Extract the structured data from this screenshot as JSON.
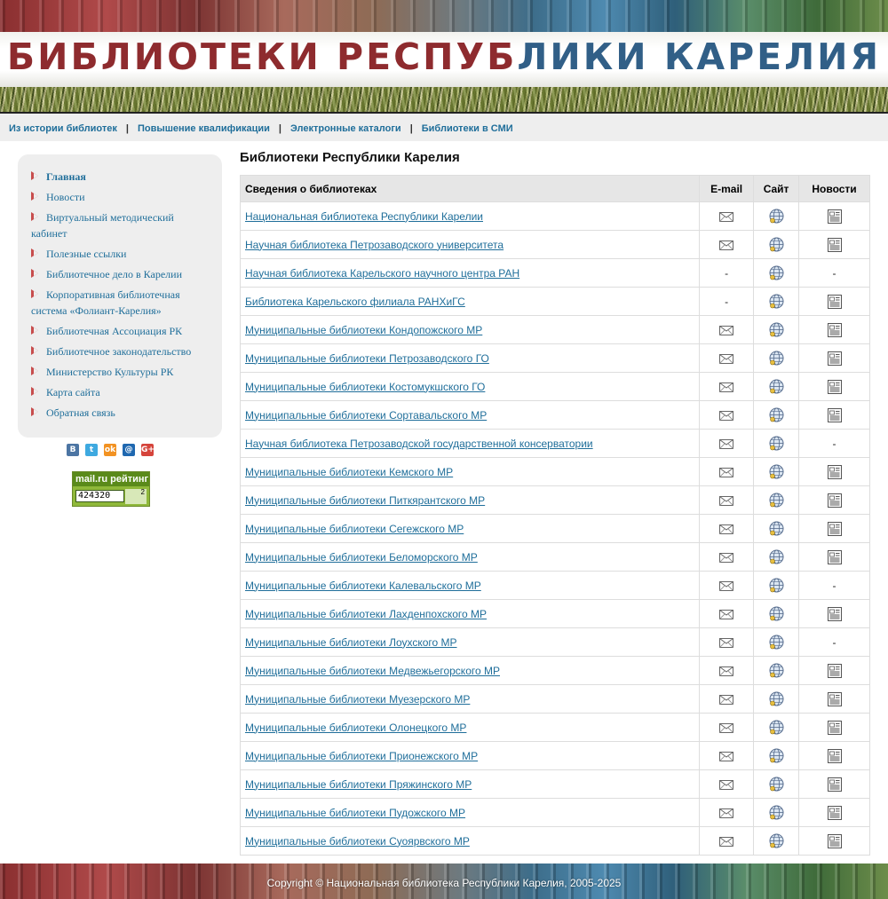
{
  "site": {
    "banner_title_part1": "БИБЛИОТЕКИ РЕСПУБ",
    "banner_title_part2": "ЛИКИ КАРЕЛИЯ"
  },
  "topnav": {
    "items": [
      "Из истории библиотек",
      "Повышение квалификации",
      "Электронные каталоги",
      "Библиотеки в СМИ"
    ],
    "separator": "|"
  },
  "sidebar": {
    "items": [
      "Главная",
      "Новости",
      "Виртуальный методический кабинет",
      "Полезные ссылки",
      "Библиотечное дело в Карелии",
      "Корпоративная библиотечная система «Фолиант-Карелия»",
      "Библиотечная Ассоциация РК",
      "Библиотечное законодательство",
      "Министерство Культуры РК",
      "Карта сайта",
      "Обратная связь"
    ],
    "active_index": 0
  },
  "social": {
    "icons": [
      {
        "name": "vkontakte-icon",
        "glyph": "В",
        "color": "#4c75a3"
      },
      {
        "name": "twitter-icon",
        "glyph": "t",
        "color": "#3ea9e0"
      },
      {
        "name": "odnoklassniki-icon",
        "glyph": "ok",
        "color": "#f29222"
      },
      {
        "name": "mailru-icon",
        "glyph": "@",
        "color": "#1f68b0"
      },
      {
        "name": "googleplus-icon",
        "glyph": "G+",
        "color": "#d5443b"
      }
    ]
  },
  "counter": {
    "logo": "mail.ru рейтинг",
    "value": "424320",
    "side": "2"
  },
  "main": {
    "title": "Библиотеки Республики Карелия",
    "table": {
      "headers": [
        "Сведения о библиотеках",
        "E-mail",
        "Сайт",
        "Новости"
      ],
      "rows": [
        {
          "name": "Национальная библиотека Республики Карелии",
          "email": true,
          "site": true,
          "news": true
        },
        {
          "name": "Научная библиотека Петрозаводского университета",
          "email": true,
          "site": true,
          "news": true
        },
        {
          "name": "Научная библиотека Карельского научного центра РАН",
          "email": false,
          "site": true,
          "news": false
        },
        {
          "name": "Библиотека Карельского филиала РАНХиГС",
          "email": false,
          "site": true,
          "news": true
        },
        {
          "name": "Муниципальные библиотеки Кондопожского МР",
          "email": true,
          "site": true,
          "news": true
        },
        {
          "name": "Муниципальные библиотеки Петрозаводского ГО",
          "email": true,
          "site": true,
          "news": true
        },
        {
          "name": "Муниципальные библиотеки Костомукшского ГО",
          "email": true,
          "site": true,
          "news": true
        },
        {
          "name": "Муниципальные библиотеки Сортавальского МР",
          "email": true,
          "site": true,
          "news": true
        },
        {
          "name": "Научная библиотека Петрозаводской государственной консерватории",
          "email": true,
          "site": true,
          "news": false
        },
        {
          "name": "Муниципальные библиотеки Кемского МР",
          "email": true,
          "site": true,
          "news": true
        },
        {
          "name": "Муниципальные библиотеки Питкярантского МР",
          "email": true,
          "site": true,
          "news": true
        },
        {
          "name": "Муниципальные библиотеки Сегежского МР",
          "email": true,
          "site": true,
          "news": true
        },
        {
          "name": "Муниципальные библиотеки Беломорского МР",
          "email": true,
          "site": true,
          "news": true
        },
        {
          "name": "Муниципальные библиотеки Калевальского МР",
          "email": true,
          "site": true,
          "news": false
        },
        {
          "name": "Муниципальные библиотеки Лахденпохского МР",
          "email": true,
          "site": true,
          "news": true
        },
        {
          "name": "Муниципальные библиотеки Лоухского МР",
          "email": true,
          "site": true,
          "news": false
        },
        {
          "name": "Муниципальные библиотеки Медвежьегорского МР",
          "email": true,
          "site": true,
          "news": true
        },
        {
          "name": "Муниципальные библиотеки Муезерского МР",
          "email": true,
          "site": true,
          "news": true
        },
        {
          "name": "Муниципальные библиотеки Олонецкого МР",
          "email": true,
          "site": true,
          "news": true
        },
        {
          "name": "Муниципальные библиотеки Прионежского МР",
          "email": true,
          "site": true,
          "news": true
        },
        {
          "name": "Муниципальные библиотеки Пряжинского МР",
          "email": true,
          "site": true,
          "news": true
        },
        {
          "name": "Муниципальные библиотеки Пудожского МР",
          "email": true,
          "site": true,
          "news": true
        },
        {
          "name": "Муниципальные библиотеки Суоярвского МР",
          "email": true,
          "site": true,
          "news": true
        }
      ],
      "missing_marker": "-"
    }
  },
  "footer": {
    "copyright": "Copyright © Национальная библиотека Республики Карелия, 2005-2025"
  },
  "colors": {
    "link": "#1f6e9a",
    "banner_red": "#8e2b2e",
    "banner_blue": "#315f87",
    "sidebar_bg": "#eeeeee",
    "table_header_bg": "#e6e6e6"
  }
}
